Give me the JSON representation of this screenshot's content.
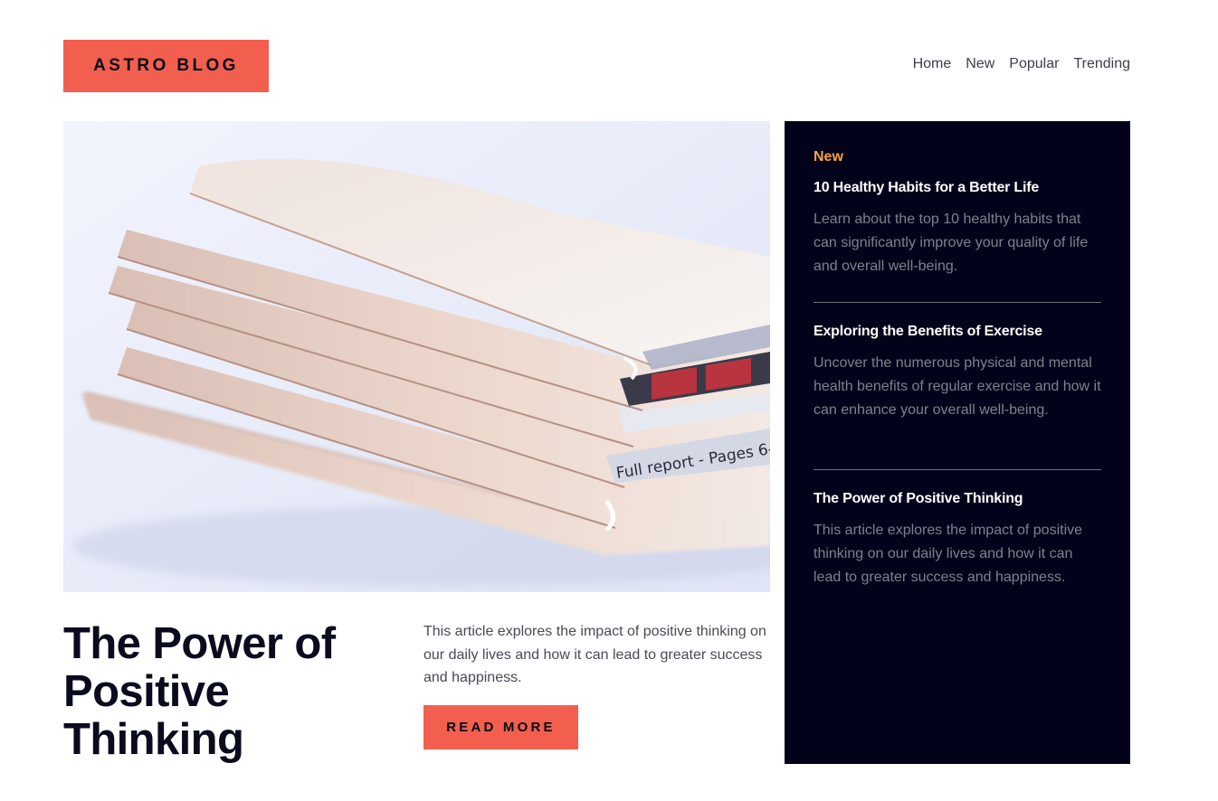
{
  "header": {
    "logo": "ASTRO BLOG",
    "nav": [
      "Home",
      "New",
      "Popular",
      "Trending"
    ]
  },
  "hero": {
    "image": "newspaper-stack-photo",
    "title": "The Power of Positive Thinking",
    "description": "This article explores the impact of positive thinking on our daily lives and how it can lead to greater success and happiness.",
    "button": "READ MORE"
  },
  "sidebar": {
    "heading": "New",
    "items": [
      {
        "title": "10 Healthy Habits for a Better Life",
        "description": "Learn about the top 10 healthy habits that can significantly improve your quality of life and overall well-being."
      },
      {
        "title": "Exploring the Benefits of Exercise",
        "description": "Uncover the numerous physical and mental health benefits of regular exercise and how it can enhance your overall well-being."
      },
      {
        "title": "The Power of Positive Thinking",
        "description": "This article explores the impact of positive thinking on our daily lives and how it can lead to greater success and happiness."
      }
    ]
  },
  "colors": {
    "accent": "#f25f4f",
    "sidebar_bg": "#02021a",
    "sidebar_heading": "#f7a641"
  }
}
